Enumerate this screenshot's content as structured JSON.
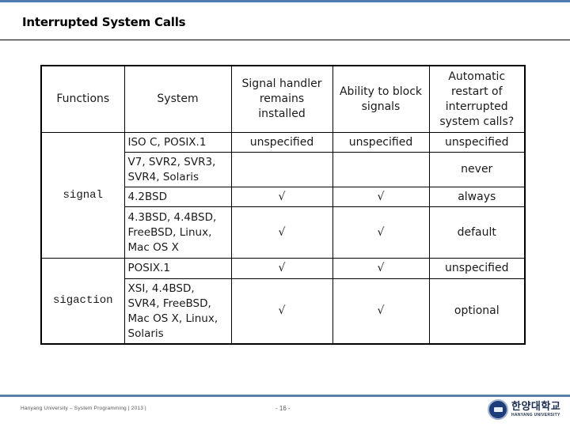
{
  "slide": {
    "title": "Interrupted System Calls",
    "accent_color": "#4f7bb0"
  },
  "table": {
    "headers": {
      "functions": "Functions",
      "system": "System",
      "handler": "Signal handler remains installed",
      "block": "Ability to block signals",
      "restart": "Automatic restart of interrupted system calls?"
    },
    "functions": {
      "signal": "signal",
      "sigaction": "sigaction"
    },
    "rows": [
      {
        "system": "ISO C, POSIX.1",
        "handler": "unspecified",
        "block": "unspecified",
        "restart": "unspecified"
      },
      {
        "system": "V7, SVR2, SVR3, SVR4, Solaris",
        "handler": "",
        "block": "",
        "restart": "never"
      },
      {
        "system": "4.2BSD",
        "handler": "√",
        "block": "√",
        "restart": "always"
      },
      {
        "system": "4.3BSD, 4.4BSD, FreeBSD, Linux, Mac OS X",
        "handler": "√",
        "block": "√",
        "restart": "default"
      },
      {
        "system": "POSIX.1",
        "handler": "√",
        "block": "√",
        "restart": "unspecified"
      },
      {
        "system": "XSI, 4.4BSD, SVR4, FreeBSD, Mac OS X, Linux, Solaris",
        "handler": "√",
        "block": "√",
        "restart": "optional"
      }
    ]
  },
  "footer": {
    "left_text": "Hanyang University – System Programming | 2013 |",
    "page_number": "- 16 -",
    "logo_korean": "한양대학교",
    "logo_english": "HANYANG UNIVERSITY"
  }
}
